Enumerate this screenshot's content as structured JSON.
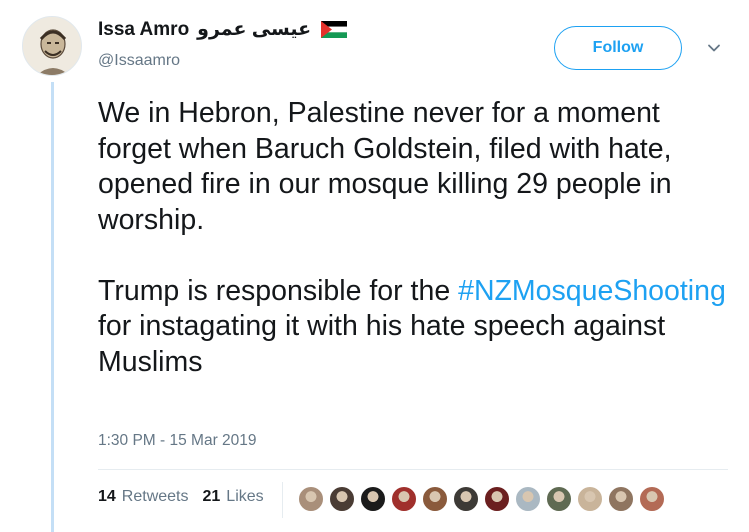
{
  "author": {
    "display_name": "Issa Amro",
    "arabic_name": "عيسى عمرو",
    "handle": "@Issaamro",
    "flag_icon": "palestine-flag-icon"
  },
  "follow_button": {
    "label": "Follow"
  },
  "menu_icon": "chevron-down-icon",
  "tweet": {
    "paragraph1": "We in Hebron, Palestine never for a moment forget when Baruch Goldstein, filed with hate, opened fire in our mosque killing 29 people in worship.",
    "paragraph2_before": "Trump is responsible for the ",
    "hashtag": "#NZMosqueShooting",
    "paragraph2_after": " for instagating it with his hate speech against Muslims",
    "timestamp": "1:30 PM - 15 Mar 2019"
  },
  "stats": {
    "retweets_count": "14",
    "retweets_label": "Retweets",
    "likes_count": "21",
    "likes_label": "Likes"
  },
  "likers": [
    {
      "name": "liker-avatar-1",
      "color": "#a98f7a"
    },
    {
      "name": "liker-avatar-2",
      "color": "#4a3c34"
    },
    {
      "name": "liker-avatar-3",
      "color": "#1b1b1b"
    },
    {
      "name": "liker-avatar-4",
      "color": "#a0302c"
    },
    {
      "name": "liker-avatar-5",
      "color": "#8a5a3c"
    },
    {
      "name": "liker-avatar-6",
      "color": "#3d3a36"
    },
    {
      "name": "liker-avatar-7",
      "color": "#6b1f1f"
    },
    {
      "name": "liker-avatar-8",
      "color": "#aab8c2"
    },
    {
      "name": "liker-avatar-9",
      "color": "#5f6a52"
    },
    {
      "name": "liker-avatar-10",
      "color": "#c9b49a"
    },
    {
      "name": "liker-avatar-11",
      "color": "#8f7560"
    },
    {
      "name": "liker-avatar-12",
      "color": "#b36a55"
    }
  ],
  "colors": {
    "accent": "#1da1f2",
    "secondary_text": "#657786",
    "thread_line": "#c4dff6"
  }
}
